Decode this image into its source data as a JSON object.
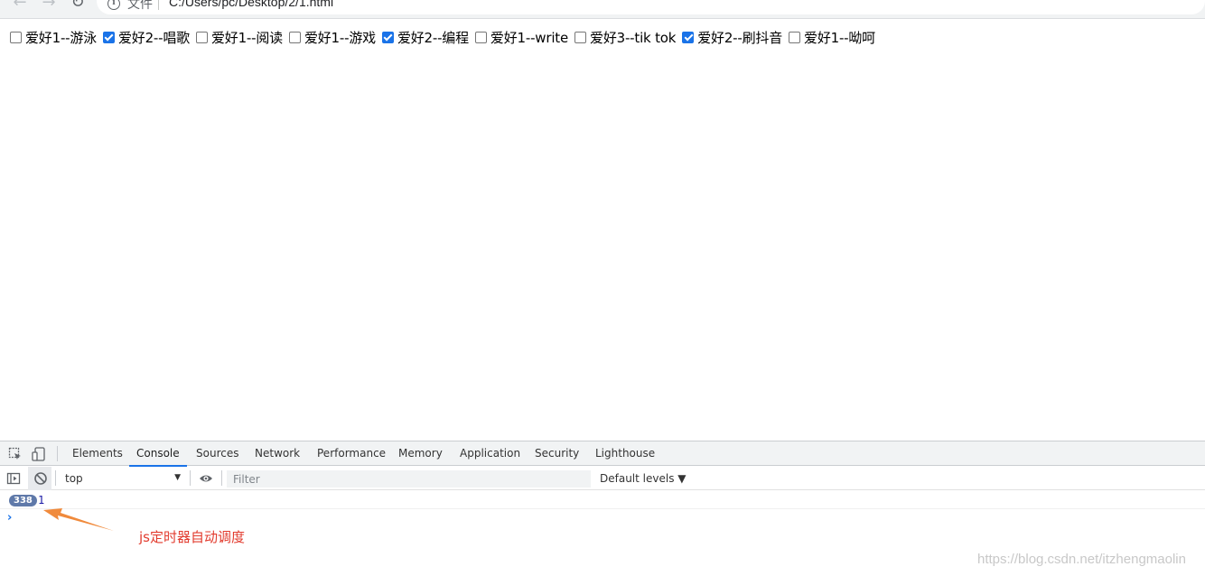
{
  "browser": {
    "nav": {
      "back_icon": "arrow-left-icon",
      "forward_icon": "arrow-right-icon",
      "reload_icon": "reload-icon"
    },
    "omnibox": {
      "info_icon": "info-icon",
      "scheme_label": "文件",
      "url": "C:/Users/pc/Desktop/2/1.html"
    }
  },
  "page": {
    "hobbies": [
      {
        "label": "爱好1--游泳",
        "checked": false
      },
      {
        "label": "爱好2--唱歌",
        "checked": true
      },
      {
        "label": "爱好1--阅读",
        "checked": false
      },
      {
        "label": "爱好1--游戏",
        "checked": false
      },
      {
        "label": "爱好2--编程",
        "checked": true
      },
      {
        "label": "爱好1--write",
        "checked": false
      },
      {
        "label": "爱好3--tik tok",
        "checked": false
      },
      {
        "label": "爱好2--刷抖音",
        "checked": true
      },
      {
        "label": "爱好1--呦呵",
        "checked": false
      }
    ]
  },
  "devtools": {
    "icons": {
      "inspect": "inspect-element-icon",
      "device": "device-toolbar-icon"
    },
    "tabs": [
      {
        "label": "Elements",
        "active": false
      },
      {
        "label": "Console",
        "active": true
      },
      {
        "label": "Sources",
        "active": false
      },
      {
        "label": "Network",
        "active": false
      },
      {
        "label": "Performance",
        "active": false
      },
      {
        "label": "Memory",
        "active": false
      },
      {
        "label": "Application",
        "active": false
      },
      {
        "label": "Security",
        "active": false
      },
      {
        "label": "Lighthouse",
        "active": false
      }
    ],
    "toolbar": {
      "sidebar_icon": "console-sidebar-icon",
      "clear_icon": "clear-console-icon",
      "context": "top",
      "eye_icon": "eye-icon",
      "filter_placeholder": "Filter",
      "levels": "Default levels ▼"
    },
    "console": {
      "messages": [
        {
          "repeat_count": "338",
          "text": "1"
        }
      ],
      "prompt": "›"
    }
  },
  "annotation": {
    "text": "js定时器自动调度",
    "color": "#e23b2e"
  },
  "watermark": "https://blog.csdn.net/itzhengmaolin",
  "colors": {
    "accent": "#1a73e8",
    "badge": "#5f79a9",
    "arrow": "#f08a3c"
  }
}
